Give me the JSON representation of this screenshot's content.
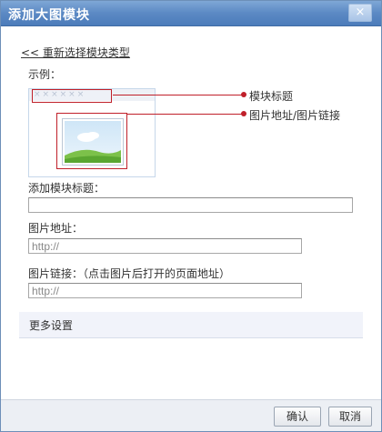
{
  "dialog": {
    "title": "添加大图模块",
    "close_symbol": "×"
  },
  "back_link": "<< 重新选择模块类型",
  "example": {
    "label": "示例：",
    "title_stars": "××××××",
    "callouts": {
      "module_title": "模块标题",
      "image_address_link": "图片地址/图片链接"
    }
  },
  "fields": {
    "module_title": {
      "label": "添加模块标题：",
      "value": ""
    },
    "image_address": {
      "label": "图片地址：",
      "value": "http://"
    },
    "image_link": {
      "label": "图片链接：（点击图片后打开的页面地址）",
      "value": "http://"
    }
  },
  "more_settings": "更多设置",
  "buttons": {
    "ok": "确认",
    "cancel": "取消"
  },
  "colors": {
    "titlebar": "#5b89c4",
    "highlight": "#c0202a"
  }
}
